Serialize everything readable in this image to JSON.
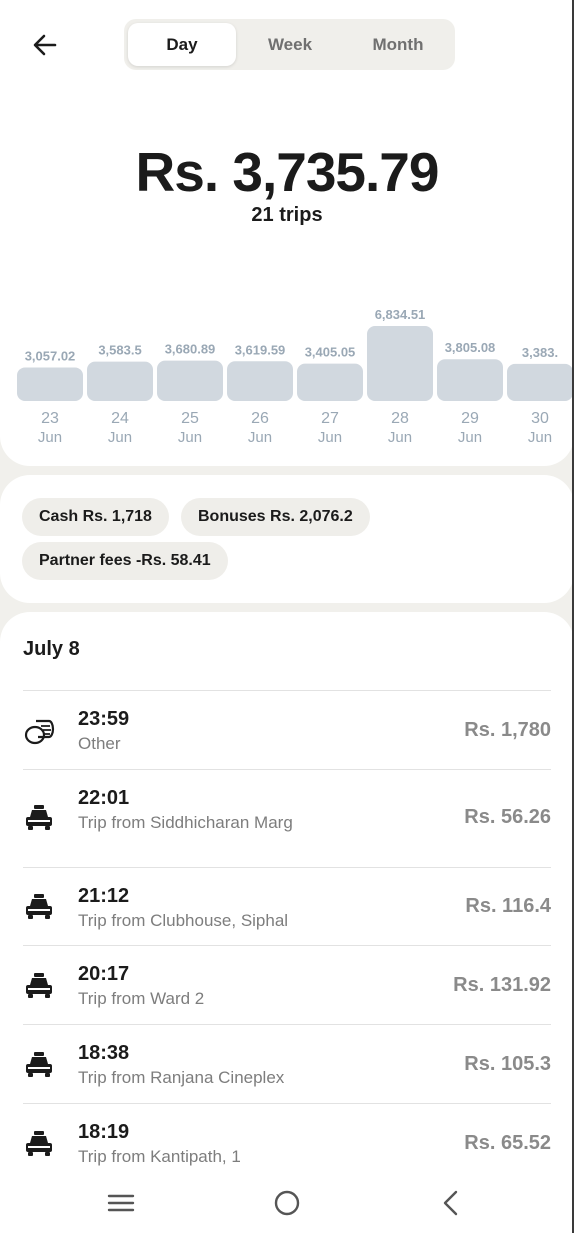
{
  "header": {
    "tabs": [
      {
        "label": "Day",
        "active": true
      },
      {
        "label": "Week",
        "active": false
      },
      {
        "label": "Month",
        "active": false
      }
    ]
  },
  "summary": {
    "amount": "Rs. 3,735.79",
    "trips": "21 trips"
  },
  "chart_data": {
    "type": "bar",
    "categories": [
      {
        "day": "23",
        "month": "Jun"
      },
      {
        "day": "24",
        "month": "Jun"
      },
      {
        "day": "25",
        "month": "Jun"
      },
      {
        "day": "26",
        "month": "Jun"
      },
      {
        "day": "27",
        "month": "Jun"
      },
      {
        "day": "28",
        "month": "Jun"
      },
      {
        "day": "29",
        "month": "Jun"
      },
      {
        "day": "30",
        "month": "Jun"
      }
    ],
    "values": [
      3057.02,
      3583.5,
      3680.89,
      3619.59,
      3405.05,
      6834.51,
      3805.08,
      3383
    ],
    "labels": [
      "3,057.02",
      "3,583.5",
      "3,680.89",
      "3,619.59",
      "3,405.05",
      "6,834.51",
      "3,805.08",
      "3,383."
    ],
    "bar_color": "#d1d8df",
    "label_color": "#9aa8b5"
  },
  "breakdown": {
    "chips": [
      "Cash Rs. 1,718",
      "Bonuses Rs. 2,076.2",
      "Partner fees -Rs. 58.41"
    ]
  },
  "transactions": {
    "date": "July 8",
    "items": [
      {
        "icon": "coins-icon",
        "time": "23:59",
        "desc": "Other",
        "amount": "Rs. 1,780"
      },
      {
        "icon": "car-icon",
        "time": "22:01",
        "desc": "Trip from Siddhicharan Marg",
        "amount": "Rs. 56.26"
      },
      {
        "icon": "car-icon",
        "time": "21:12",
        "desc": "Trip from Clubhouse, Siphal",
        "amount": "Rs. 116.4"
      },
      {
        "icon": "car-icon",
        "time": "20:17",
        "desc": "Trip from Ward 2",
        "amount": "Rs. 131.92"
      },
      {
        "icon": "car-icon",
        "time": "18:38",
        "desc": "Trip from Ranjana Cineplex",
        "amount": "Rs. 105.3"
      },
      {
        "icon": "car-icon",
        "time": "18:19",
        "desc": "Trip from Kantipath, 1",
        "amount": "Rs. 65.52"
      }
    ]
  },
  "navbar": {
    "icons": [
      "menu-icon",
      "home-circle-icon",
      "back-chevron-icon"
    ]
  }
}
